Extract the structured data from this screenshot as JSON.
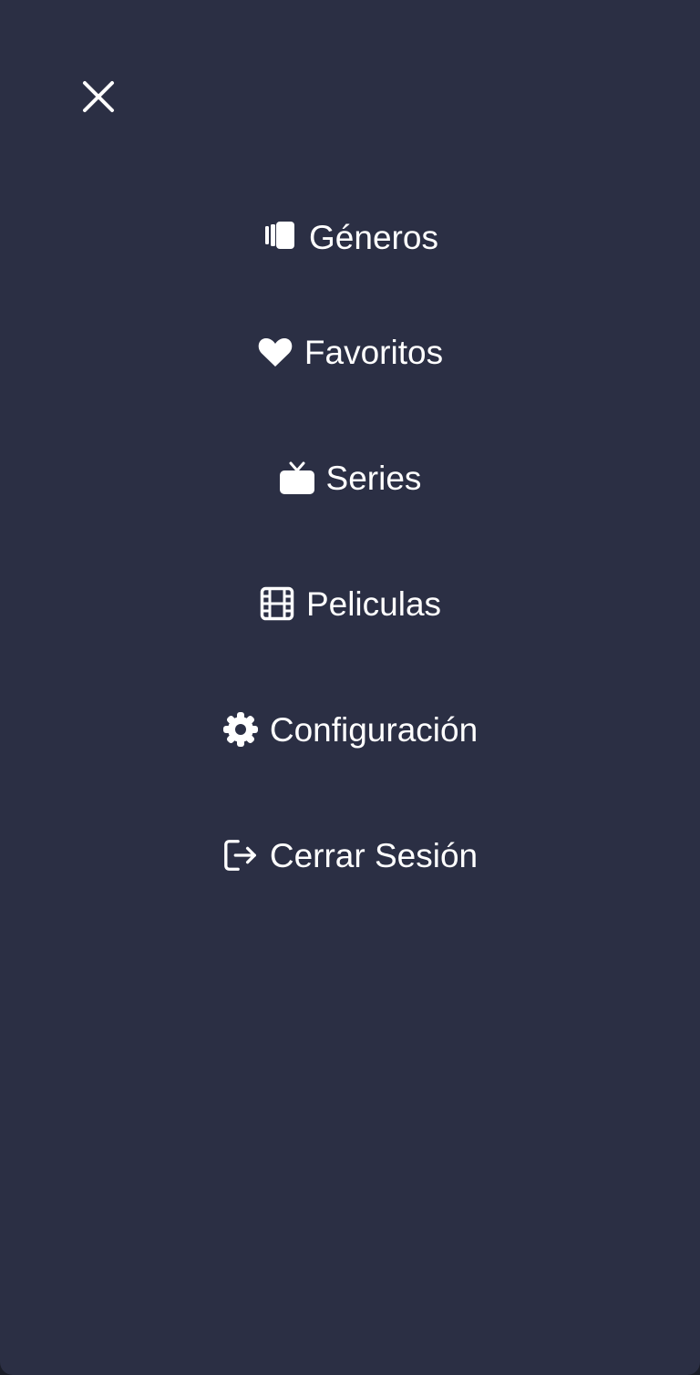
{
  "theme": {
    "background": "#2b2f44",
    "text": "#ffffff"
  },
  "close": {
    "icon": "close-icon"
  },
  "menu": {
    "items": [
      {
        "label": "Géneros",
        "icon": "cards-icon"
      },
      {
        "label": "Favoritos",
        "icon": "heart-icon"
      },
      {
        "label": "Series",
        "icon": "tv-icon"
      },
      {
        "label": "Peliculas",
        "icon": "film-icon"
      },
      {
        "label": "Configuración",
        "icon": "gear-icon"
      },
      {
        "label": "Cerrar Sesión",
        "icon": "logout-icon"
      }
    ]
  }
}
